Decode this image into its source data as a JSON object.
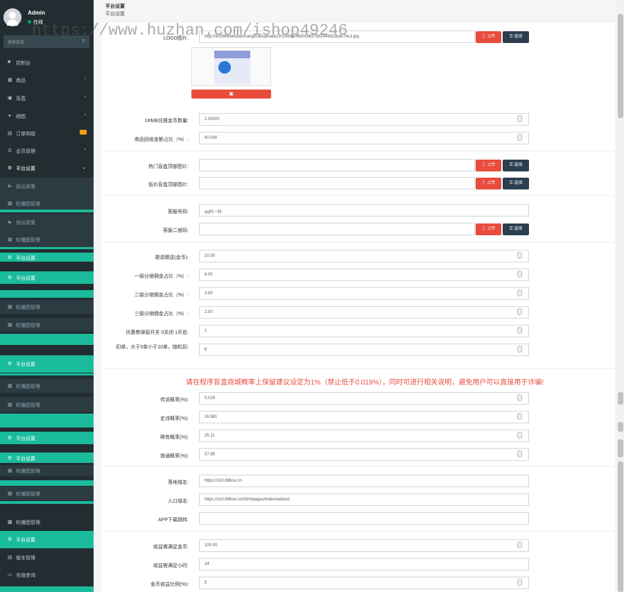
{
  "user": {
    "name": "Admin",
    "status": "在线"
  },
  "search": {
    "placeholder": "搜索菜单"
  },
  "menu": {
    "dashboard": "控制台",
    "goods": "商品",
    "blindbox": "盲盒",
    "showcase": "晒图",
    "orders": "订单明细",
    "members": "会员管理",
    "platform": "平台设置",
    "protocol": "协议政策",
    "carousel": "轮播图管理",
    "script": "版本管理",
    "recharge": "充值查询"
  },
  "page": {
    "title": "平台设置",
    "subtitle": "平台设置"
  },
  "watermark": "https://www.huzhan.com/ishop49246",
  "logo": {
    "label": "LOGO图片:",
    "value": "http://3c0586/eec8a/changecal/uploads/202495e0f600c88375b2946d1dcdc74c1.jpg"
  },
  "buttons": {
    "upload": "上传",
    "select": "选择"
  },
  "fields": {
    "rmb_coin": {
      "label": "1RMB兑换金币数量:",
      "value": "1.00000"
    },
    "recycle_ratio": {
      "label": "商品回收金额占比（%）:",
      "value": "60.000"
    },
    "hot_top_img": {
      "label": "热门盲盒顶部图片:",
      "value": ""
    },
    "cheap_top_img": {
      "label": "低价盲盒顶部图片:",
      "value": ""
    },
    "service_no": {
      "label": "客服号码:",
      "value": "qq扫一扫"
    },
    "service_qr": {
      "label": "客服二维码:",
      "value": ""
    },
    "invite_gift": {
      "label": "邀请赠送(金币):",
      "value": "10.00"
    },
    "level1": {
      "label": "一级分销佣金占比（%）:",
      "value": "6.00"
    },
    "level2": {
      "label": "二级分销佣金占比（%）:",
      "value": "3.00"
    },
    "level3": {
      "label": "三级分销佣金占比（%）:",
      "value": "2.00"
    },
    "coupon_switch": {
      "label": "优惠券弹窗开关 0关闭 1开启:",
      "value": "1"
    },
    "deduct": {
      "label": "扣单，大于5单小于10单，随机扣:",
      "value": "6"
    },
    "legend": {
      "label": "传说概率(%):",
      "value": "0.019"
    },
    "epic": {
      "label": "史诗概率(%):",
      "value": "16.981"
    },
    "rare": {
      "label": "稀有概率(%):",
      "value": "25.11"
    },
    "normal": {
      "label": "普通概率(%):",
      "value": "57.89"
    },
    "landing_domain": {
      "label": "落地域名:",
      "value": "https://v10.69box.cn"
    },
    "entry_domain": {
      "label": "入口域名:",
      "value": "https://v10.69box.cn/h5/#/pages/index/redirect"
    },
    "app_jump": {
      "label": "APP下载跳转:",
      "value": ""
    },
    "income_coin": {
      "label": "收益需满足金币:",
      "value": "100.00"
    },
    "income_hours": {
      "label": "收益需满足小时:",
      "value": "24"
    },
    "coin_ratio": {
      "label": "金币收益比例(%):",
      "value": "5"
    }
  },
  "warning": "请在程序盲盒商城概率上保留建议设定为1%（禁止低于0.019%），同时可进行相关说明，避免用户可以直接用于诈骗!",
  "colors": {
    "sidebar": "#222d32",
    "accent": "#1abc9c",
    "danger": "#e74c3c",
    "dark_button": "#2c3e50"
  }
}
